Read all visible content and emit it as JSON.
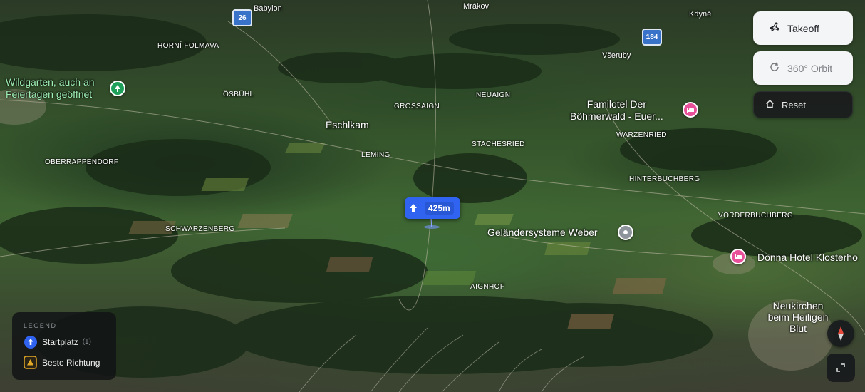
{
  "map": {
    "place_labels": {
      "babylon": "Babylon",
      "mrakov": "Mrákov",
      "kdyne": "Kdyně",
      "horni_folmava": "HORNÍ FOLMAVA",
      "vseruby": "Všeruby",
      "osbuhl": "ÖSBÜHL",
      "neuaign": "NEUAIGN",
      "grossaign": "GROSSAIGN",
      "eschlkam": "Eschlkam",
      "warzenried": "WARZENRIED",
      "staches": "STACHESRIED",
      "leming": "LEMING",
      "oberrappendorf": "OBERRAPPENDORF",
      "hinterbuchberg": "HINTERBUCHBERG",
      "vorderbuchberg": "VORDERBUCHBERG",
      "schwarzenberg": "SCHWARZENBERG",
      "aignhof": "AIGNHOF",
      "neukirchen": "Neukirchen beim Heiligen Blut"
    },
    "road_shields": {
      "r26": "26",
      "r184": "184"
    },
    "pois": {
      "wildgarten_line1": "Wildgarten, auch an",
      "wildgarten_line2": "Feiertagen geöffnet",
      "familotel_line1": "Familotel Der",
      "familotel_line2": "Böhmerwald - Euer...",
      "gelaender": "Geländersysteme Weber",
      "donna": "Donna Hotel Klosterho"
    },
    "pin_icons": {
      "wildgarten": "tree-icon",
      "familotel": "hotel-bed-icon",
      "gelaender": "location-pin-icon",
      "donna": "hotel-bed-icon"
    },
    "pin_colors": {
      "park": "#1fa05a",
      "hotel": "#e8509a",
      "generic": "#8e949b"
    },
    "marker": {
      "icon": "arrow-up-icon",
      "altitude": "425m",
      "color": "#2f63f0"
    }
  },
  "controls": {
    "takeoff": {
      "label": "Takeoff",
      "icon": "plane-icon"
    },
    "orbit": {
      "label": "360° Orbit",
      "icon": "rotate-icon"
    },
    "reset": {
      "label": "Reset",
      "icon": "home-icon"
    }
  },
  "legend": {
    "title": "LEGEND",
    "items": [
      {
        "label": "Startplatz",
        "count": "(1)",
        "icon": "arrow-up-circle-icon",
        "color": "#2f63f0"
      },
      {
        "label": "Beste Richtung",
        "icon": "triangle-icon",
        "color": "#e3a826"
      }
    ]
  },
  "nav": {
    "compass_icon": "compass-icon",
    "fullscreen_icon": "fullscreen-icon"
  }
}
